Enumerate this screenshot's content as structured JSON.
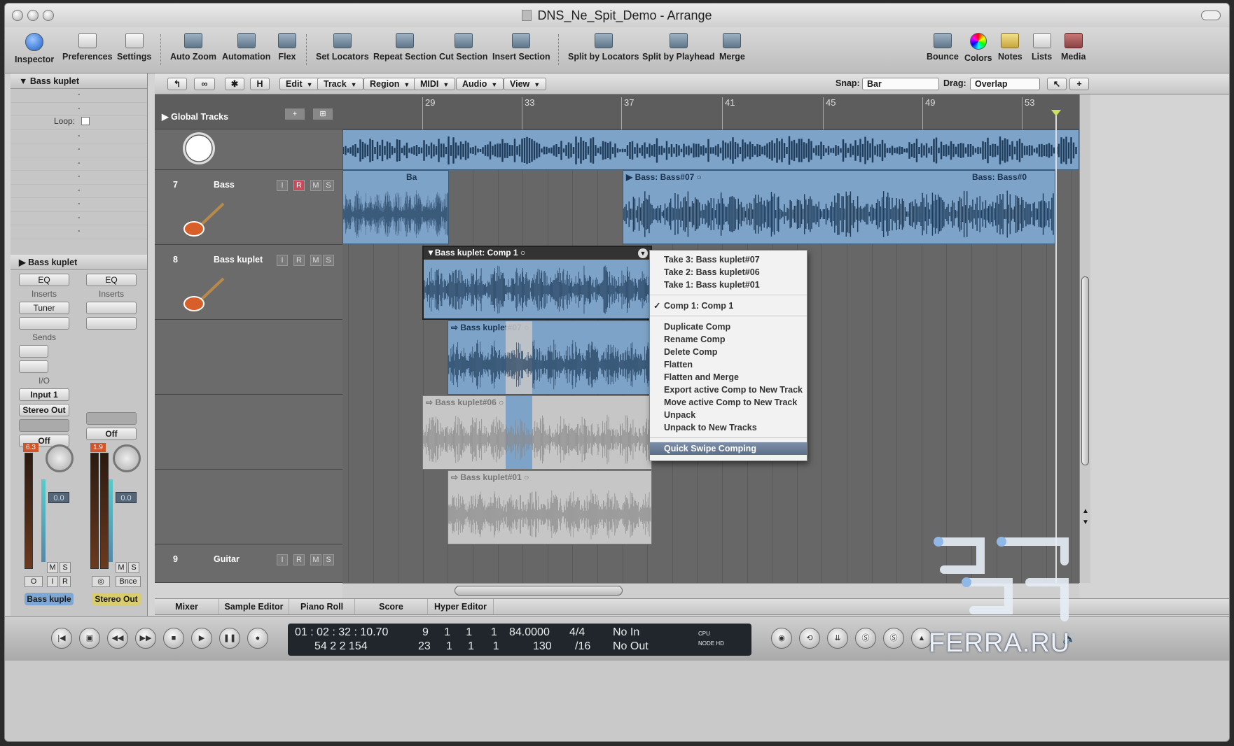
{
  "window": {
    "title": "DNS_Ne_Spit_Demo - Arrange"
  },
  "toolbar": {
    "items": [
      {
        "label": "Inspector",
        "icon": "info-icon"
      },
      {
        "label": "Preferences",
        "icon": "preferences-icon"
      },
      {
        "label": "Settings",
        "icon": "settings-icon"
      },
      {
        "label": "Auto Zoom",
        "icon": "auto-zoom-icon"
      },
      {
        "label": "Automation",
        "icon": "automation-icon"
      },
      {
        "label": "Flex",
        "icon": "flex-icon"
      },
      {
        "label": "Set Locators",
        "icon": "set-locators-icon"
      },
      {
        "label": "Repeat Section",
        "icon": "repeat-section-icon"
      },
      {
        "label": "Cut Section",
        "icon": "cut-section-icon"
      },
      {
        "label": "Insert Section",
        "icon": "insert-section-icon"
      },
      {
        "label": "Split by Locators",
        "icon": "split-locators-icon"
      },
      {
        "label": "Split by Playhead",
        "icon": "split-playhead-icon"
      },
      {
        "label": "Merge",
        "icon": "merge-icon"
      },
      {
        "label": "Bounce",
        "icon": "bounce-icon"
      },
      {
        "label": "Colors",
        "icon": "colors-icon"
      },
      {
        "label": "Notes",
        "icon": "notes-icon"
      },
      {
        "label": "Lists",
        "icon": "lists-icon"
      },
      {
        "label": "Media",
        "icon": "media-icon"
      }
    ]
  },
  "inspector": {
    "region_header": "Bass kuplet",
    "loop_label": "Loop:",
    "dash": "-",
    "track_header": "Bass kuplet",
    "strip1": {
      "eq": "EQ",
      "inserts": "Inserts",
      "plugin": "Tuner",
      "sends": "Sends",
      "io": "I/O",
      "input": "Input 1",
      "output": "Stereo Out",
      "auto": "Off",
      "peak": "6.3",
      "fader": "0.0",
      "m": "M",
      "s": "S",
      "o": "O",
      "i": "I",
      "r": "R",
      "name": "Bass kuple"
    },
    "strip2": {
      "eq": "EQ",
      "inserts": "Inserts",
      "auto": "Off",
      "peak": "1.9",
      "fader": "0.0",
      "m": "M",
      "s": "S",
      "bnce": "Bnce",
      "name": "Stereo Out"
    }
  },
  "local_menu": {
    "h": "H",
    "items": [
      "Edit",
      "Track",
      "Region",
      "MIDI",
      "Audio",
      "View"
    ],
    "snap_label": "Snap:",
    "snap_value": "Bar",
    "drag_label": "Drag:",
    "drag_value": "Overlap"
  },
  "global_tracks": "Global Tracks",
  "tracks": [
    {
      "num": "7",
      "name": "Bass",
      "i": "I",
      "r": "R",
      "m": "M",
      "s": "S"
    },
    {
      "num": "8",
      "name": "Bass kuplet",
      "i": "I",
      "r": "R",
      "m": "M",
      "s": "S"
    },
    {
      "num": "9",
      "name": "Guitar",
      "i": "I",
      "r": "R",
      "m": "M",
      "s": "S"
    }
  ],
  "ruler": [
    "29",
    "33",
    "37",
    "41",
    "45",
    "49",
    "53"
  ],
  "regions": {
    "bass_a": "Ba",
    "bass_b": "Bass: Bass#07",
    "bass_c": "Bass: Bass#0",
    "comp": "Bass kuplet: Comp 1",
    "take07": "Bass kuplet#07",
    "take06": "Bass kuplet#06",
    "take01": "Bass kuplet#01"
  },
  "context_menu": {
    "group1": [
      "Take 3: Bass kuplet#07",
      "Take 2: Bass kuplet#06",
      "Take 1: Bass kuplet#01"
    ],
    "checked": "Comp 1: Comp 1",
    "check": "✓",
    "group2": [
      "Duplicate Comp",
      "Rename Comp",
      "Delete Comp",
      "Flatten",
      "Flatten and Merge",
      "Export active Comp to New Track",
      "Move active Comp to New Track",
      "Unpack",
      "Unpack to New Tracks"
    ],
    "highlighted": "Quick Swipe Comping"
  },
  "bottom_tabs": [
    "Mixer",
    "Sample Editor",
    "Piano Roll",
    "Score",
    "Hyper Editor"
  ],
  "lcd": {
    "smpte": "01 : 02 : 32 : 10.70",
    "bars": "54   2   2  154",
    "pos1": "9     1     1      1",
    "pos2": "23     1     1      1",
    "tempo": "84.0000",
    "tempo2": "130",
    "sig": "4/4",
    "div": "/16",
    "in": "No In",
    "out": "No Out",
    "cpu": "CPU",
    "hd": "NODE HD"
  },
  "watermark": "FERRA.RU",
  "colors": {
    "region_blue": "#7ea3c8",
    "record_red": "#c94a5a",
    "menu_highlight": "#6a7d98"
  }
}
